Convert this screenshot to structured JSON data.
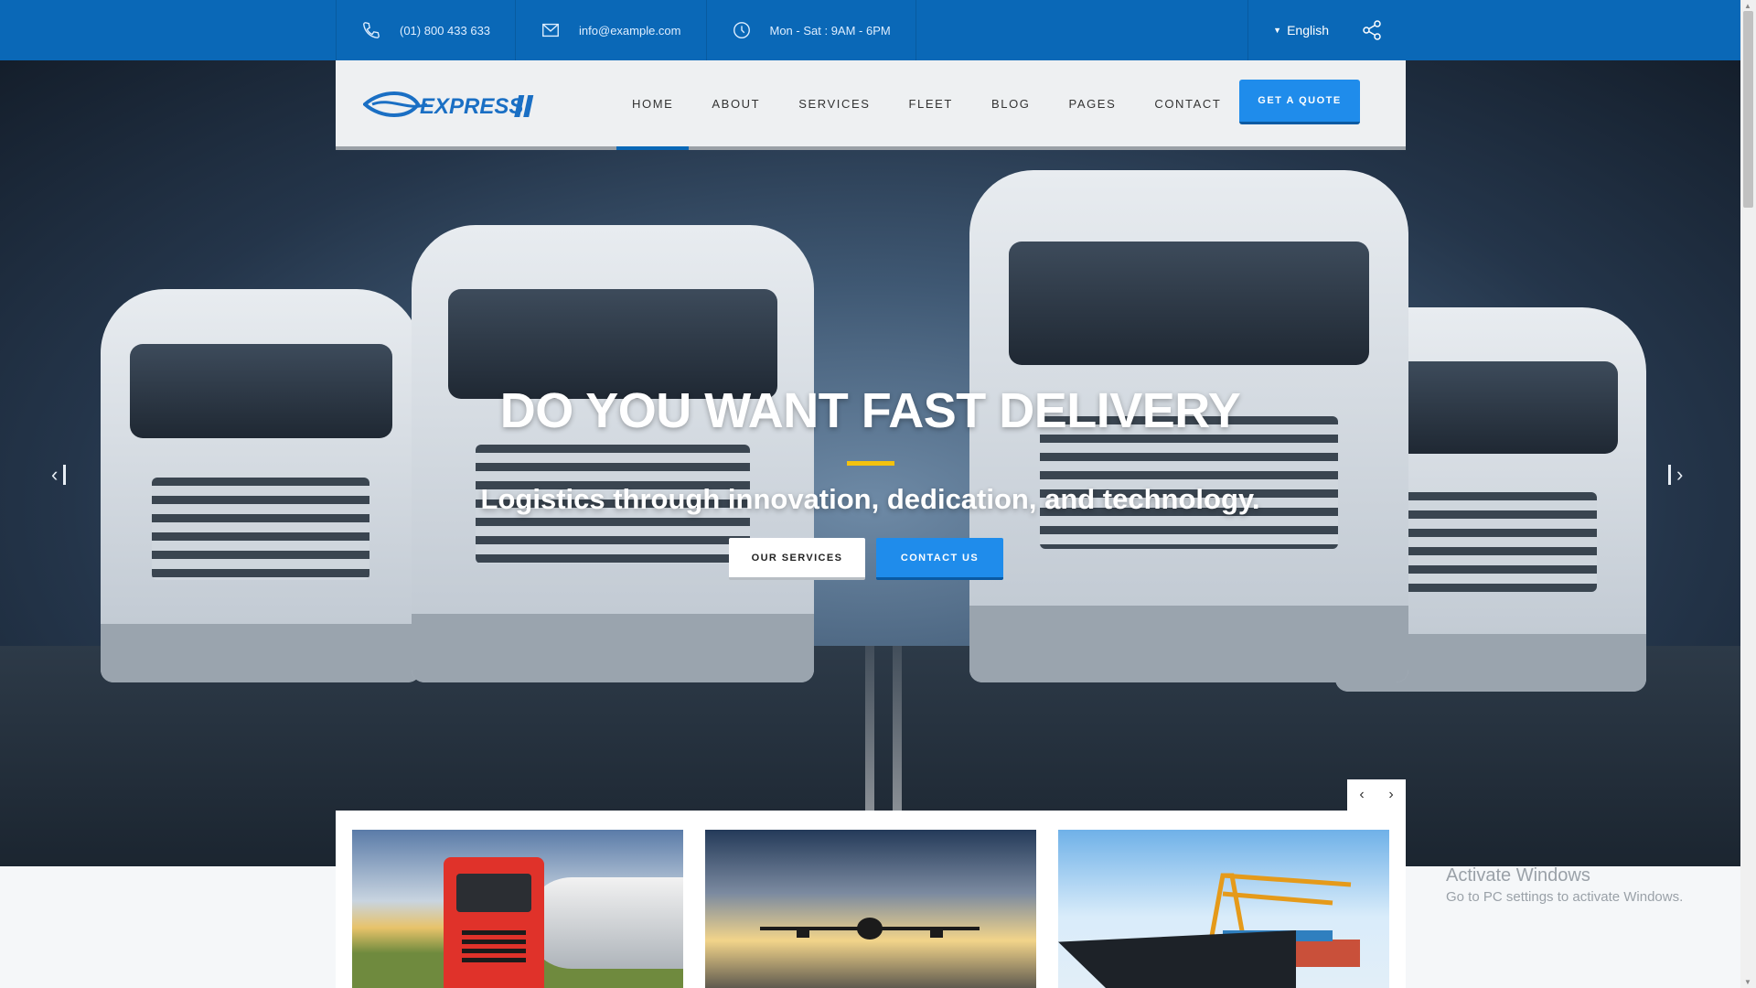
{
  "topbar": {
    "phone": "(01) 800 433 633",
    "email": "info@example.com",
    "hours": "Mon - Sat : 9AM - 6PM",
    "language": "English",
    "icons": [
      "phone-icon",
      "mail-icon",
      "clock-icon",
      "share-icon"
    ]
  },
  "nav": {
    "logo_text": "EXPRESS",
    "items": [
      {
        "label": "HOME",
        "active": true
      },
      {
        "label": "ABOUT",
        "active": false
      },
      {
        "label": "SERVICES",
        "active": false
      },
      {
        "label": "FLEET",
        "active": false
      },
      {
        "label": "BLOG",
        "active": false
      },
      {
        "label": "PAGES",
        "active": false
      },
      {
        "label": "CONTACT",
        "active": false
      }
    ],
    "quote_button": "GET A QUOTE"
  },
  "hero": {
    "title": "DO YOU WANT FAST DELIVERY",
    "subtitle": "Logistics through innovation, dedication, and technology.",
    "primary_button": "OUR SERVICES",
    "secondary_button": "CONTACT US"
  },
  "watermark": {
    "title": "Activate Windows",
    "subtitle": "Go to PC settings to activate Windows."
  },
  "colors": {
    "brand_blue": "#0a68b7",
    "button_blue": "#1f8ceb",
    "accent_yellow": "#f4c20d"
  }
}
